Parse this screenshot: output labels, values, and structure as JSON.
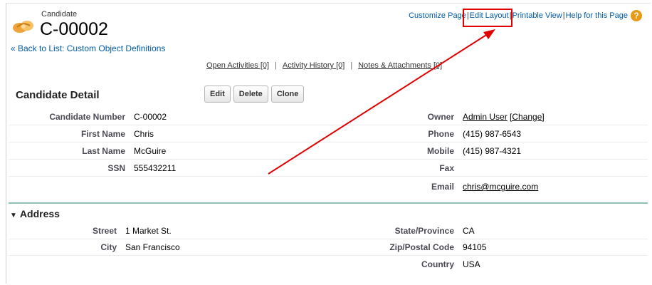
{
  "header": {
    "object_type": "Candidate",
    "record_name": "C-00002",
    "back_link": "« Back to List: Custom Object Definitions"
  },
  "top_links": {
    "customize": "Customize Page",
    "edit_layout": "Edit Layout",
    "printable": "Printable View",
    "help": "Help for this Page",
    "separator": "|",
    "help_icon_glyph": "?"
  },
  "related_links": [
    {
      "label": "Open Activities [0]"
    },
    {
      "label": "Activity History [0]"
    },
    {
      "label": "Notes & Attachments [0]"
    }
  ],
  "related_separator": "|",
  "detail": {
    "title": "Candidate Detail",
    "buttons": [
      "Edit",
      "Delete",
      "Clone"
    ],
    "rows": [
      {
        "l1": "Candidate Number",
        "v1": "C-00002",
        "l2": "Owner",
        "v2": "Admin User",
        "v2_extra": "[Change]"
      },
      {
        "l1": "First Name",
        "v1": "Chris",
        "l2": "Phone",
        "v2": "(415) 987-6543"
      },
      {
        "l1": "Last Name",
        "v1": "McGuire",
        "l2": "Mobile",
        "v2": "(415) 987-4321"
      },
      {
        "l1": "SSN",
        "v1": "555432211",
        "l2": "Fax",
        "v2": ""
      },
      {
        "l1": "",
        "v1": "",
        "l2": "Email",
        "v2": "chris@mcguire.com"
      }
    ]
  },
  "address": {
    "title": "Address",
    "toggle_glyph": "▼",
    "rows": [
      {
        "l1": "Street",
        "v1": "1 Market St.",
        "l2": "State/Province",
        "v2": "CA"
      },
      {
        "l1": "City",
        "v1": "San Francisco",
        "l2": "Zip/Postal Code",
        "v2": "94105"
      },
      {
        "l1": "",
        "v1": "",
        "l2": "Country",
        "v2": "USA"
      }
    ]
  },
  "colors": {
    "link": "#015ba7",
    "annotation": "#e00000",
    "section_rule": "#8ec1b5",
    "help_icon": "#e89a12"
  }
}
